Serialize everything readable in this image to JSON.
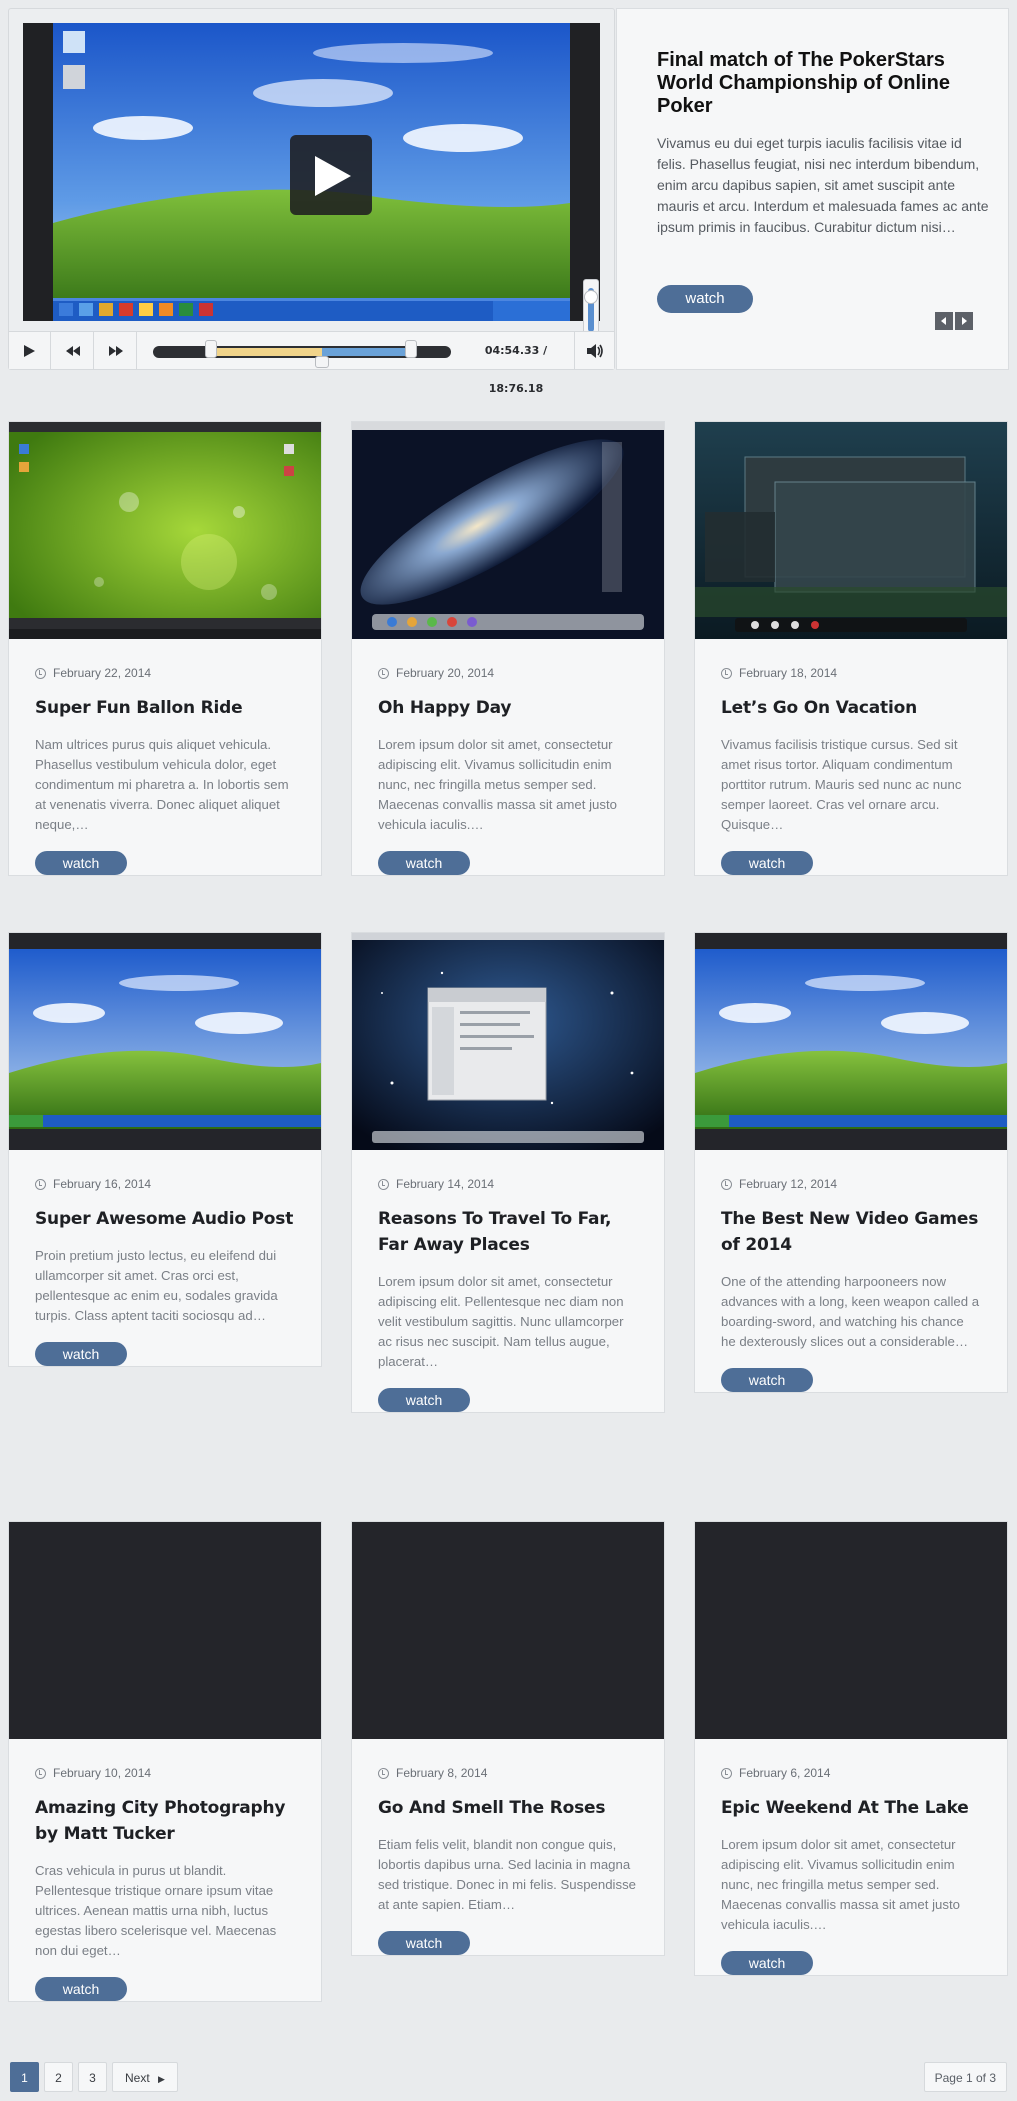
{
  "featured": {
    "title": "Final match of The PokerStars World Championship of Online Poker",
    "excerpt": "Vivamus eu dui eget turpis iaculis facilisis vitae id felis. Phasellus feugiat, nisi nec interdum bibendum, enim arcu dapibus sapien, sit amet suscipit ante mauris et arcu. Interdum et malesuada fames ac ante ipsum primis in faucibus. Curabitur dictum nisi…",
    "watch_label": "watch",
    "timecode": "04:54.33 / 18:76.18",
    "icons": {
      "play": "play-icon",
      "rewind": "rewind-icon",
      "forward": "fast-forward-icon",
      "volume": "volume-icon",
      "prev": "chevron-left-icon",
      "next": "chevron-right-icon"
    }
  },
  "posts": [
    {
      "date": "February 22, 2014",
      "title": "Super Fun Ballon Ride",
      "excerpt": "Nam ultrices purus quis aliquet vehicula. Phasellus vestibulum vehicula dolor, eget condimentum mi pharetra a. In lobortis sem at venenatis viverra. Donec aliquet aliquet neque,…",
      "watch": "watch",
      "thumb": "green-bokeh-desktop"
    },
    {
      "date": "February 20, 2014",
      "title": "Oh Happy Day",
      "excerpt": "Lorem ipsum dolor sit amet, consectetur adipiscing elit. Vivamus sollicitudin enim nunc, nec fringilla metus semper sed. Maecenas convallis massa sit amet justo vehicula iaculis.…",
      "watch": "watch",
      "thumb": "galaxy-desktop"
    },
    {
      "date": "February 18, 2014",
      "title": "Let’s Go On Vacation",
      "excerpt": "Vivamus facilisis tristique cursus. Sed sit amet risus tortor. Aliquam condimentum porttitor rutrum. Mauris sed nunc ac nunc semper laoreet. Cras vel ornare arcu. Quisque…",
      "watch": "watch",
      "thumb": "dark-teal-desktop"
    },
    {
      "date": "February 16, 2014",
      "title": "Super Awesome Audio Post",
      "excerpt": "Proin pretium justo lectus, eu eleifend dui ullamcorper sit amet. Cras orci est, pellentesque ac enim eu, sodales gravida turpis. Class aptent taciti sociosqu ad…",
      "watch": "watch",
      "thumb": "bliss-desktop"
    },
    {
      "date": "February 14, 2014",
      "title": "Reasons To Travel To Far, Far Away Places",
      "excerpt": "Lorem ipsum dolor sit amet, consectetur adipiscing elit. Pellentesque nec diam non velit vestibulum sagittis. Nunc ullamcorper ac risus nec suscipit. Nam tellus augue, placerat…",
      "watch": "watch",
      "thumb": "space-desktop"
    },
    {
      "date": "February 12, 2014",
      "title": "The Best New Video Games of 2014",
      "excerpt": "One of the attending harpooneers now advances with a long, keen weapon called a boarding-sword, and watching his chance he dexterously slices out a considerable…",
      "watch": "watch",
      "thumb": "bliss-desktop"
    },
    {
      "date": "February 10, 2014",
      "title": "Amazing City Photography by Matt Tucker",
      "excerpt": "Cras vehicula in purus ut blandit. Pellentesque tristique ornare ipsum vitae ultrices. Aenean mattis urna nibh, luctus egestas libero scelerisque vel. Maecenas non dui eget…",
      "watch": "watch",
      "thumb": "empty"
    },
    {
      "date": "February 8, 2014",
      "title": "Go And Smell The Roses",
      "excerpt": "Etiam felis velit, blandit non congue quis, lobortis dapibus urna. Sed lacinia in magna sed tristique. Donec in mi felis. Suspendisse at ante sapien. Etiam…",
      "watch": "watch",
      "thumb": "empty"
    },
    {
      "date": "February 6, 2014",
      "title": "Epic Weekend At The Lake",
      "excerpt": "Lorem ipsum dolor sit amet, consectetur adipiscing elit. Vivamus sollicitudin enim nunc, nec fringilla metus semper sed. Maecenas convallis massa sit amet justo vehicula iaculis.…",
      "watch": "watch",
      "thumb": "empty"
    }
  ],
  "pagination": {
    "pages": [
      "1",
      "2",
      "3"
    ],
    "current": "1",
    "next_label": "Next",
    "page_of": "Page 1 of 3"
  },
  "colors": {
    "accent": "#4e6e97",
    "background": "#e9ebed",
    "card": "#f6f7f8",
    "thumb_empty": "#24252a"
  }
}
